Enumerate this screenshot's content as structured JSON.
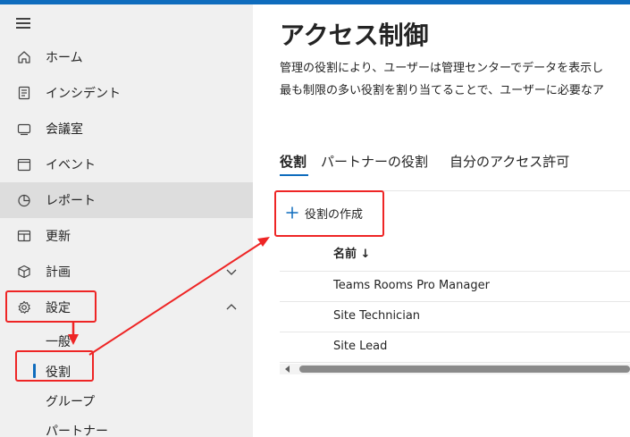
{
  "sidebar": {
    "items": [
      {
        "label": "ホーム",
        "icon": "home-icon"
      },
      {
        "label": "インシデント",
        "icon": "incident-icon"
      },
      {
        "label": "会議室",
        "icon": "meeting-room-icon"
      },
      {
        "label": "イベント",
        "icon": "calendar-icon"
      },
      {
        "label": "レポート",
        "icon": "report-icon",
        "selected": true
      },
      {
        "label": "更新",
        "icon": "update-icon"
      },
      {
        "label": "計画",
        "icon": "plan-icon",
        "expandable": true,
        "expanded": false
      },
      {
        "label": "設定",
        "icon": "gear-icon",
        "expandable": true,
        "expanded": true
      }
    ],
    "settings_subitems": [
      {
        "label": "一般"
      },
      {
        "label": "役割",
        "selected": true
      },
      {
        "label": "グループ"
      },
      {
        "label": "パートナー"
      }
    ]
  },
  "main": {
    "title": "アクセス制御",
    "description_line1": "管理の役割により、ユーザーは管理センターでデータを表示し",
    "description_line2": "最も制限の多い役割を割り当てることで、ユーザーに必要なア",
    "tabs": [
      {
        "label": "役割",
        "active": true
      },
      {
        "label": "パートナーの役割"
      },
      {
        "label": "自分のアクセス許可"
      }
    ],
    "create_button_label": "役割の作成",
    "table": {
      "column_header": "名前 ↓",
      "rows": [
        "Teams Rooms Pro Manager",
        "Site Technician",
        "Site Lead"
      ]
    }
  },
  "colors": {
    "accent": "#0f6cbd",
    "annotation": "#ee2525",
    "sidebar_bg": "#f0f0f0",
    "selected_bg": "#dddddd"
  }
}
